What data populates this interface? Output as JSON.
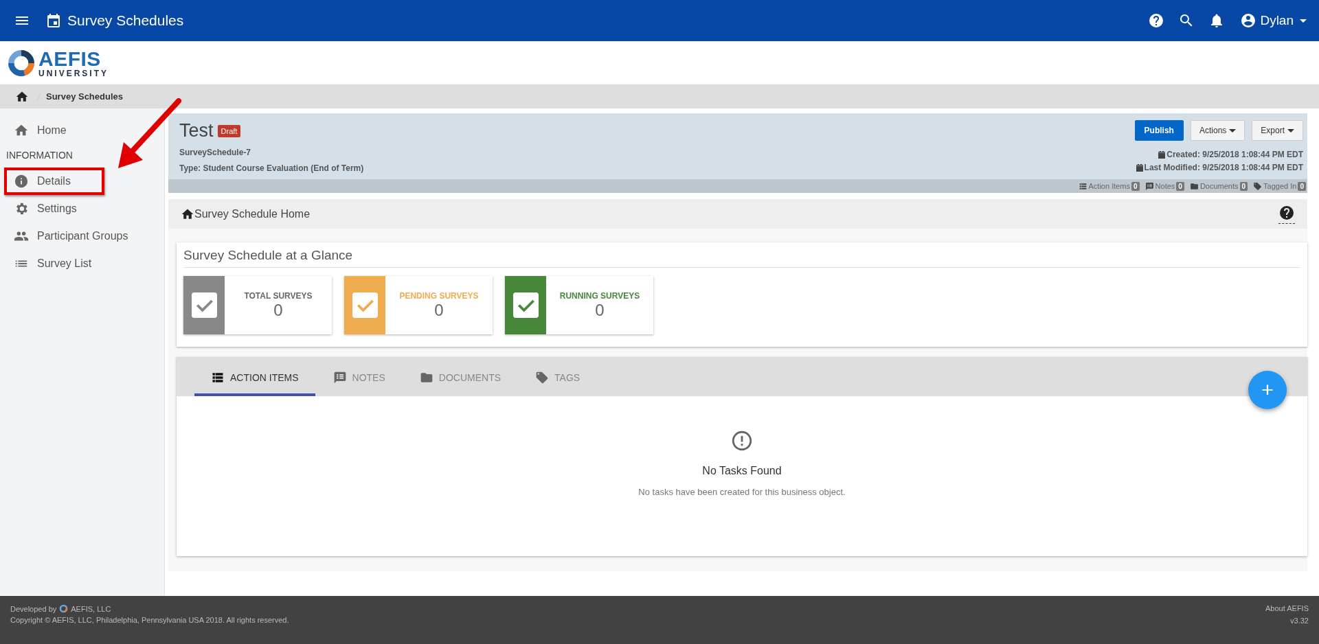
{
  "app_bar": {
    "title": "Survey Schedules",
    "user": "Dylan"
  },
  "logo": {
    "name": "AEFIS",
    "subtitle": "UNIVERSITY"
  },
  "breadcrumb": [
    "Survey Schedules"
  ],
  "sidebar": {
    "items": [
      {
        "kind": "link",
        "label": "Home",
        "highlighted": false
      },
      {
        "kind": "heading",
        "label": "INFORMATION"
      },
      {
        "kind": "link",
        "label": "Details",
        "highlighted": true
      },
      {
        "kind": "link",
        "label": "Settings",
        "highlighted": false
      },
      {
        "kind": "link",
        "label": "Participant Groups",
        "highlighted": false
      },
      {
        "kind": "link",
        "label": "Survey List",
        "highlighted": false
      }
    ]
  },
  "record": {
    "title": "Test",
    "status": "Draft",
    "id": "SurveySchedule-7",
    "type": "Type: Student Course Evaluation (End of Term)",
    "buttons": [
      {
        "label": "Publish",
        "kind": "primary"
      },
      {
        "label": "Actions",
        "kind": "dropdown"
      },
      {
        "label": "Export",
        "kind": "dropdown"
      }
    ],
    "created": "Created: 9/25/2018 1:08:44 PM EDT",
    "modified": "Last Modified: 9/25/2018 1:08:44 PM EDT",
    "counters": [
      {
        "label": "Action Items",
        "count": "0"
      },
      {
        "label": "Notes",
        "count": "0"
      },
      {
        "label": "Documents",
        "count": "0"
      },
      {
        "label": "Tagged In",
        "count": "0"
      }
    ]
  },
  "section_bar": {
    "title": "Survey Schedule Home"
  },
  "glance": {
    "title": "Survey Schedule at a Glance",
    "cards": [
      {
        "label": "TOTAL SURVEYS",
        "value": "0",
        "color": "#888888"
      },
      {
        "label": "PENDING SURVEYS",
        "value": "0",
        "color": "#efac4e"
      },
      {
        "label": "RUNNING SURVEYS",
        "value": "0",
        "color": "#46873a"
      }
    ]
  },
  "tabs": [
    {
      "label": "ACTION ITEMS",
      "selected": true
    },
    {
      "label": "NOTES",
      "selected": false
    },
    {
      "label": "DOCUMENTS",
      "selected": false
    },
    {
      "label": "TAGS",
      "selected": false
    }
  ],
  "add_button": "+",
  "empty": {
    "title": "No Tasks Found",
    "message": "No tasks have been created for this business object."
  },
  "footer": {
    "developed_by": "Developed by",
    "company": "AEFIS, LLC",
    "copyright": "Copyright © AEFIS, LLC, Philadelphia, Pennsylvania USA 2018. All rights reserved.",
    "about": "About AEFIS",
    "version": "v3.32"
  }
}
